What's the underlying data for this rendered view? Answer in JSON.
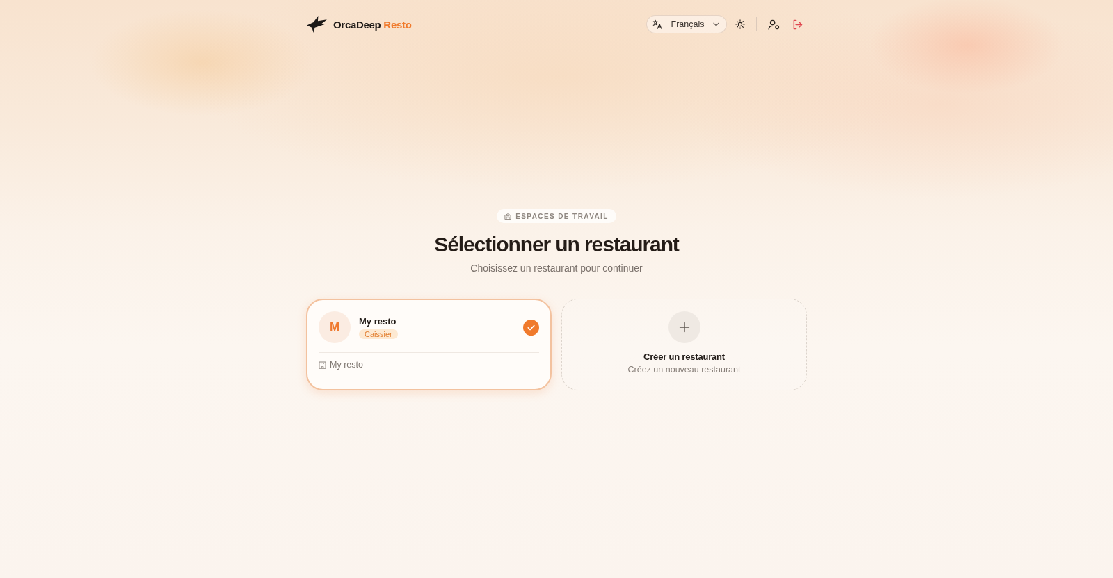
{
  "header": {
    "brand": {
      "name": "OrcaDeep",
      "accent": "Resto"
    },
    "language": {
      "value": "Français"
    }
  },
  "badge": "ESPACES DE TRAVAIL",
  "title": "Sélectionner un restaurant",
  "subtitle": "Choisissez un restaurant pour continuer",
  "restaurants": [
    {
      "initial": "M",
      "name": "My resto",
      "role": "Caissier",
      "location": "My resto",
      "selected": true
    }
  ],
  "create_card": {
    "title": "Créer un restaurant",
    "subtitle": "Créez un nouveau restaurant"
  }
}
